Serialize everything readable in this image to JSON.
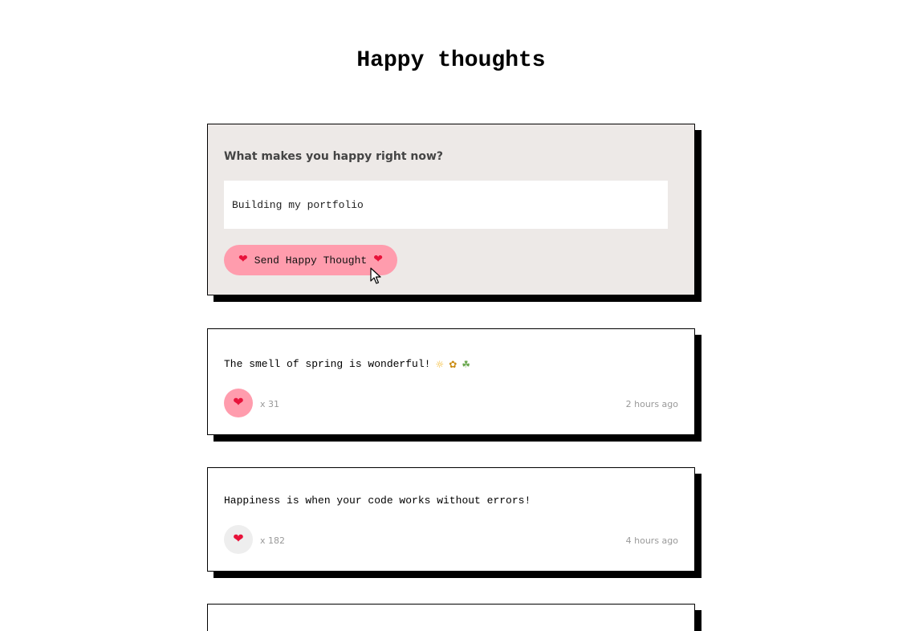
{
  "header": {
    "title": "Happy thoughts"
  },
  "form": {
    "label": "What makes you happy right now?",
    "input_value": "Building my portfolio",
    "button_label": "Send Happy Thought",
    "button_icon": "heart-icon",
    "button_color": "#ff9cad",
    "card_background": "#ede9e7"
  },
  "thoughts": [
    {
      "message": "The smell of spring is wonderful!",
      "emojis": [
        "sun-emoji",
        "sunflower-emoji",
        "herb-emoji"
      ],
      "likes": "x 31",
      "time": "2 hours ago",
      "liked": true
    },
    {
      "message": "Happiness is when your code works without errors!",
      "likes": "x 182",
      "time": "4 hours ago",
      "liked": false
    }
  ],
  "colors": {
    "liked_button": "#ff9cad",
    "unliked_button": "#eeeeee",
    "heart": "#e8123a",
    "shadow": "#000000"
  }
}
